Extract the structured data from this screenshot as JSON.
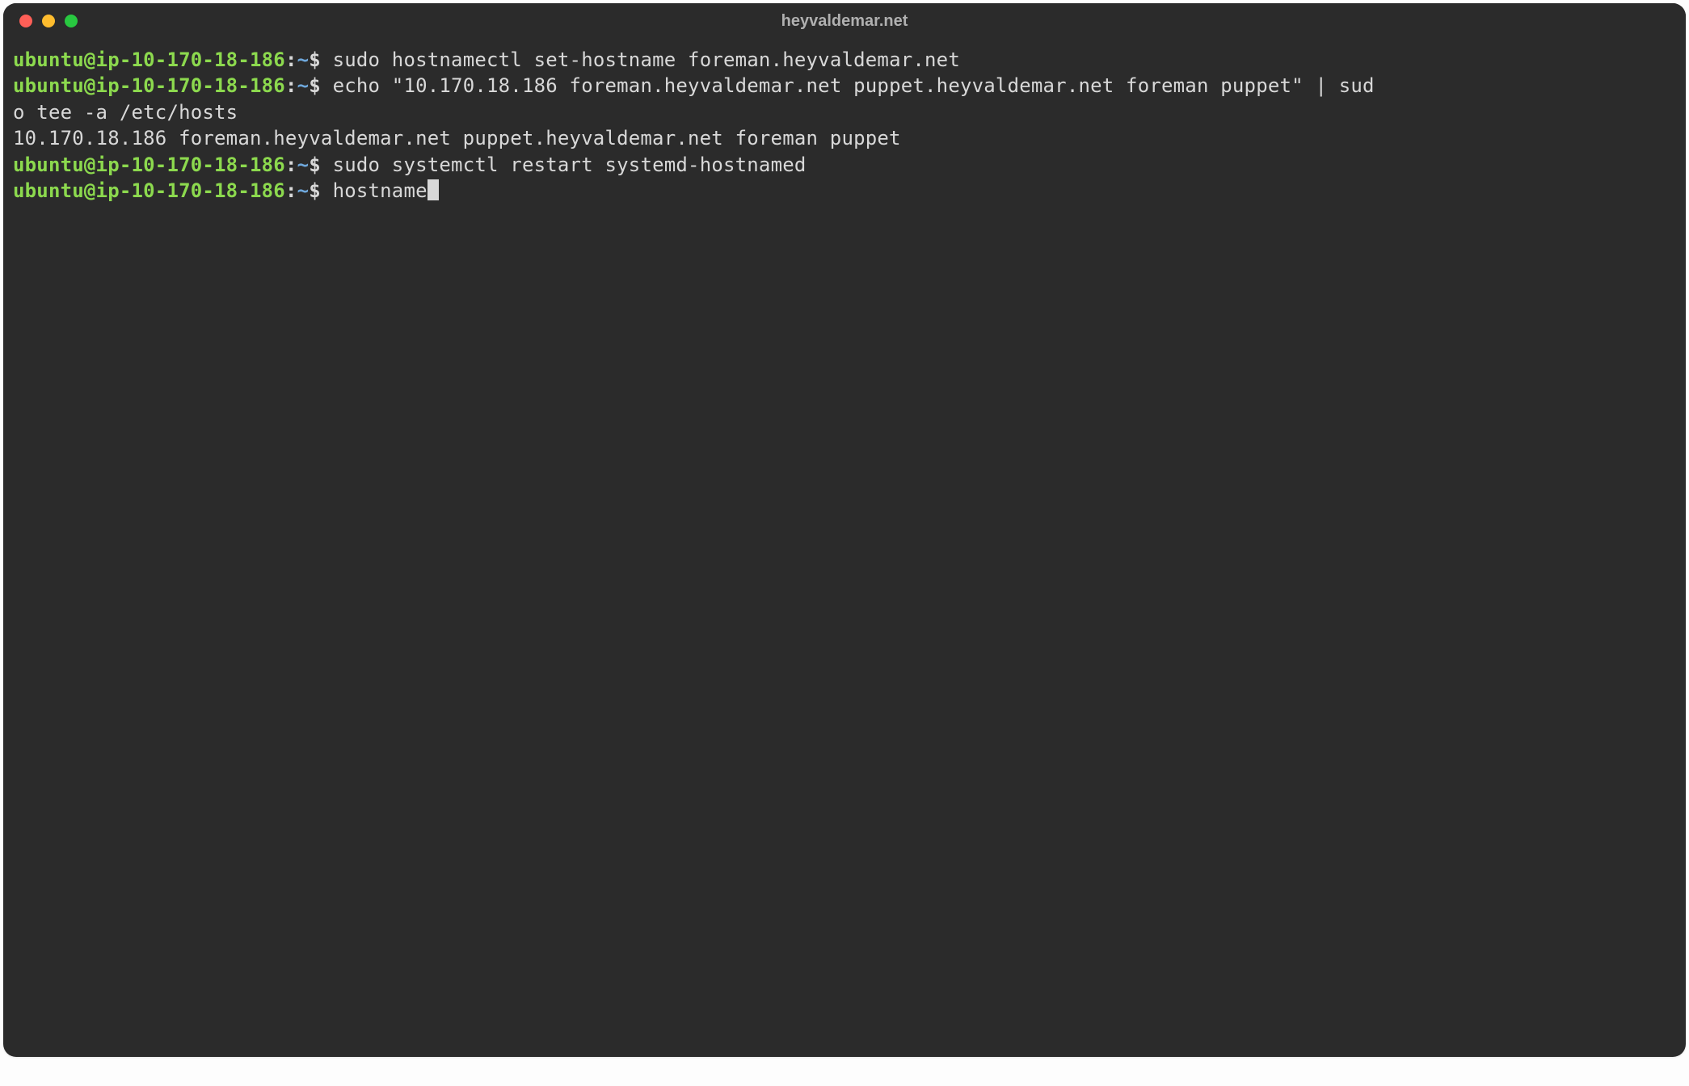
{
  "window": {
    "title": "heyvaldemar.net"
  },
  "prompt": {
    "user_host": "ubuntu@ip-10-170-18-186",
    "colon": ":",
    "path": "~",
    "symbol": "$"
  },
  "lines": [
    {
      "type": "cmd",
      "command": "sudo hostnamectl set-hostname foreman.heyvaldemar.net"
    },
    {
      "type": "cmd_wrap",
      "command_part1": "echo \"10.170.18.186 foreman.heyvaldemar.net puppet.heyvaldemar.net foreman puppet\" | sud",
      "wrap_part": "o tee -a /etc/hosts"
    },
    {
      "type": "output",
      "text": "10.170.18.186 foreman.heyvaldemar.net puppet.heyvaldemar.net foreman puppet"
    },
    {
      "type": "cmd",
      "command": "sudo systemctl restart systemd-hostnamed"
    },
    {
      "type": "cmd_cursor",
      "command": "hostname"
    }
  ]
}
